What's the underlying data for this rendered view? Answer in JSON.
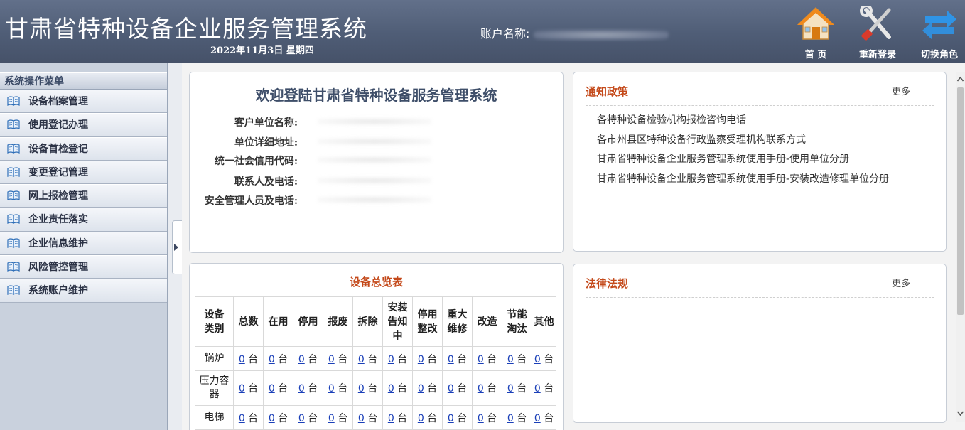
{
  "header": {
    "title": "甘肃省特种设备企业服务管理系统",
    "date": "2022年11月3日 星期四",
    "account_label": "账户名称:",
    "buttons": [
      {
        "label": "首 页",
        "icon": "home-icon"
      },
      {
        "label": "重新登录",
        "icon": "tools-icon"
      },
      {
        "label": "切换角色",
        "icon": "switch-arrows-icon"
      }
    ]
  },
  "sidebar": {
    "heading": "系统操作菜单",
    "items": [
      {
        "label": "设备档案管理"
      },
      {
        "label": "使用登记办理"
      },
      {
        "label": "设备首检登记"
      },
      {
        "label": "变更登记管理"
      },
      {
        "label": "网上报检管理"
      },
      {
        "label": "企业责任落实"
      },
      {
        "label": "企业信息维护"
      },
      {
        "label": "风险管控管理"
      },
      {
        "label": "系统账户维护"
      }
    ]
  },
  "welcome": {
    "title": "欢迎登陆甘肃省特种设备服务管理系统",
    "fields": [
      {
        "label": "客户单位名称:"
      },
      {
        "label": "单位详细地址:"
      },
      {
        "label": "统一社会信用代码:"
      },
      {
        "label": "联系人及电话:"
      },
      {
        "label": "安全管理人员及电话:"
      }
    ]
  },
  "notice": {
    "title": "通知政策",
    "more": "更多",
    "items": [
      "各特种设备检验机构报检咨询电话",
      "各市州县区特种设备行政监察受理机构联系方式",
      "甘肃省特种设备企业服务管理系统使用手册-使用单位分册",
      "甘肃省特种设备企业服务管理系统使用手册-安装改造修理单位分册"
    ]
  },
  "law": {
    "title": "法律法规",
    "more": "更多"
  },
  "equipment_table": {
    "title": "设备总览表",
    "unit": "台",
    "headers": [
      "设备\n类别",
      "总数",
      "在用",
      "停用",
      "报废",
      "拆除",
      "安装\n告知\n中",
      "停用\n整改",
      "重大\n维修",
      "改造",
      "节能\n淘汰",
      "其他"
    ],
    "rows": [
      {
        "category": "锅炉",
        "counts": [
          0,
          0,
          0,
          0,
          0,
          0,
          0,
          0,
          0,
          0,
          0
        ]
      },
      {
        "category": "压力容器",
        "counts": [
          0,
          0,
          0,
          0,
          0,
          0,
          0,
          0,
          0,
          0,
          0
        ]
      },
      {
        "category": "电梯",
        "counts": [
          0,
          0,
          0,
          0,
          0,
          0,
          0,
          0,
          0,
          0,
          0
        ]
      }
    ]
  }
}
